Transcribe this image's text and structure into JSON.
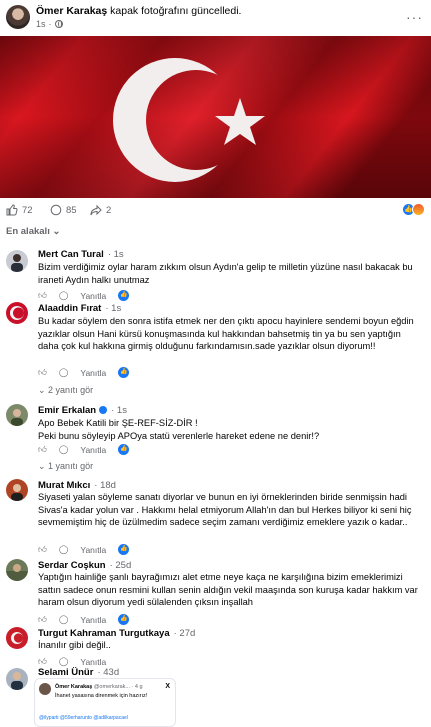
{
  "post": {
    "author": "Ömer Karakaş",
    "action": "kapak fotoğrafını güncelledi.",
    "time": "1s",
    "more": "···"
  },
  "stats": {
    "likes": "72",
    "comments": "85",
    "shares": "2"
  },
  "sort_label": "En alakalı",
  "reply_label": "Yanıtla",
  "comments": [
    {
      "name": "Mert Can Tural",
      "time": "1s",
      "text": "Bizim verdiğimiz oylar haram zıkkım olsun Aydın'a gelip te milletin yüzüne nasıl bakacak bu iraneti Aydın halkı unutmaz"
    },
    {
      "name": "Alaaddin Fırat",
      "time": "1s",
      "text": "Bu kadar söylem den sonra istifa etmek ner den çıktı apocu hayinlere sendemi boyun eğdin yazıklar olsun Hani kürsü konuşmasında kul hakkından bahsetmiş tin ya bu sen yaptığın daha çok kul hakkına girmiş olduğunu farkındamısın.sade yazıklar olsun diyorum!!",
      "replies": "2 yanıtı gör"
    },
    {
      "name": "Emir Erkalan",
      "time": "1s",
      "text": "Apo Bebek Katili bir ŞE-REF-SİZ-DİR !\nPeki bunu söyleyip APOya statü verenlerle hareket edene ne denir!?",
      "replies": "1 yanıtı gör"
    },
    {
      "name": "Murat Mıkcı",
      "time": "18d",
      "text": "Siyaseti yalan söyleme sanatı diyorlar ve bunun en iyi örneklerinden biride senmişsin hadi Sivas'a kadar yolun var . Hakkımı helal etmiyorum Allah'ın dan bul Herkes biliyor ki seni hiç sevmemiştim hiç de üzülmedim sadece seçim zamanı verdiğimiz emeklere yazık o kadar.."
    },
    {
      "name": "Serdar Coşkun",
      "time": "25d",
      "text": "Yaptığın hainliğe şanlı bayrağımızı alet etme neye kaça ne karşılığına bizim emeklerimizi sattın sadece onun resmini kullan senin aldığın vekil maaşında son kuruşa kadar hakkım var haram olsun diyorum yedi sülalenden çıksın inşallah"
    },
    {
      "name": "Turgut Kahraman Turgutkaya",
      "time": "27d",
      "text": "İnanılır gibi değil.."
    },
    {
      "name": "Selami Ünür",
      "time": "43d",
      "text": ""
    }
  ],
  "embed": {
    "name": "Ömer Karakaş",
    "handle": "@omerkarak... · 4 g",
    "line": "İhanet yasasına direnmek için hazırız!",
    "tags": "@ilyparti @59erharunto @adilkarpacael",
    "x": "X"
  },
  "colors": {
    "flag_red": "#d4141c",
    "accent": "#1877f2",
    "muted": "#65676b"
  }
}
